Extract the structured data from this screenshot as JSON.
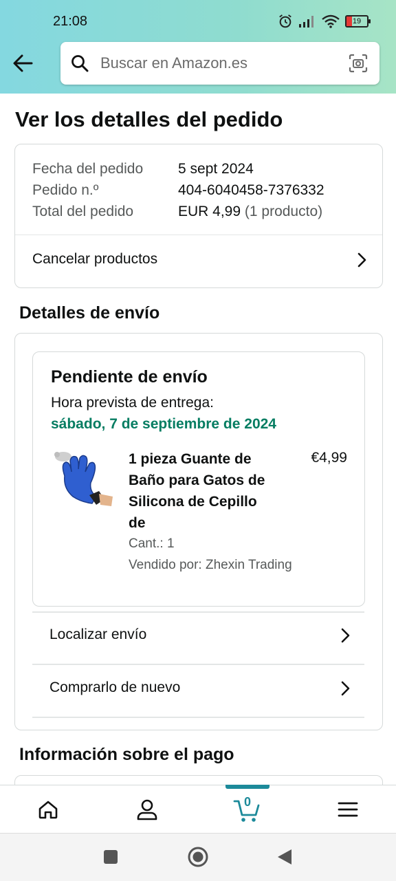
{
  "status_bar": {
    "time": "21:08",
    "battery": "19"
  },
  "search": {
    "placeholder": "Buscar en Amazon.es"
  },
  "page": {
    "title": "Ver los detalles del pedido"
  },
  "order": {
    "rows": [
      {
        "label": "Fecha del pedido",
        "value": "5 sept 2024",
        "extra": ""
      },
      {
        "label": "Pedido n.º",
        "value": "404-6040458-7376332",
        "extra": ""
      },
      {
        "label": "Total del pedido",
        "value": "EUR 4,99",
        "extra": "(1 producto)"
      }
    ],
    "cancel_label": "Cancelar productos"
  },
  "shipping": {
    "section_title": "Detalles de envío",
    "status": "Pendiente de envío",
    "eta_label": "Hora prevista de entrega:",
    "eta_date": "sábado, 7 de septiembre de 2024",
    "eta_color": "#067d62",
    "product": {
      "title": "1 pieza Guante de Baño para Gatos de Silicona de Cepillo de",
      "price": "€4,99",
      "qty": "Cant.: 1",
      "seller": "Vendido por: Zhexin Trading"
    },
    "track_label": "Localizar envío",
    "buy_again_label": "Comprarlo de nuevo"
  },
  "payment": {
    "section_title": "Información sobre el pago"
  },
  "bottom_nav": {
    "cart_count": "0",
    "accent": "#1c8a9a"
  },
  "theme": {
    "header_gradient_start": "#84d8e0",
    "header_gradient_end": "#a7e4c6"
  }
}
